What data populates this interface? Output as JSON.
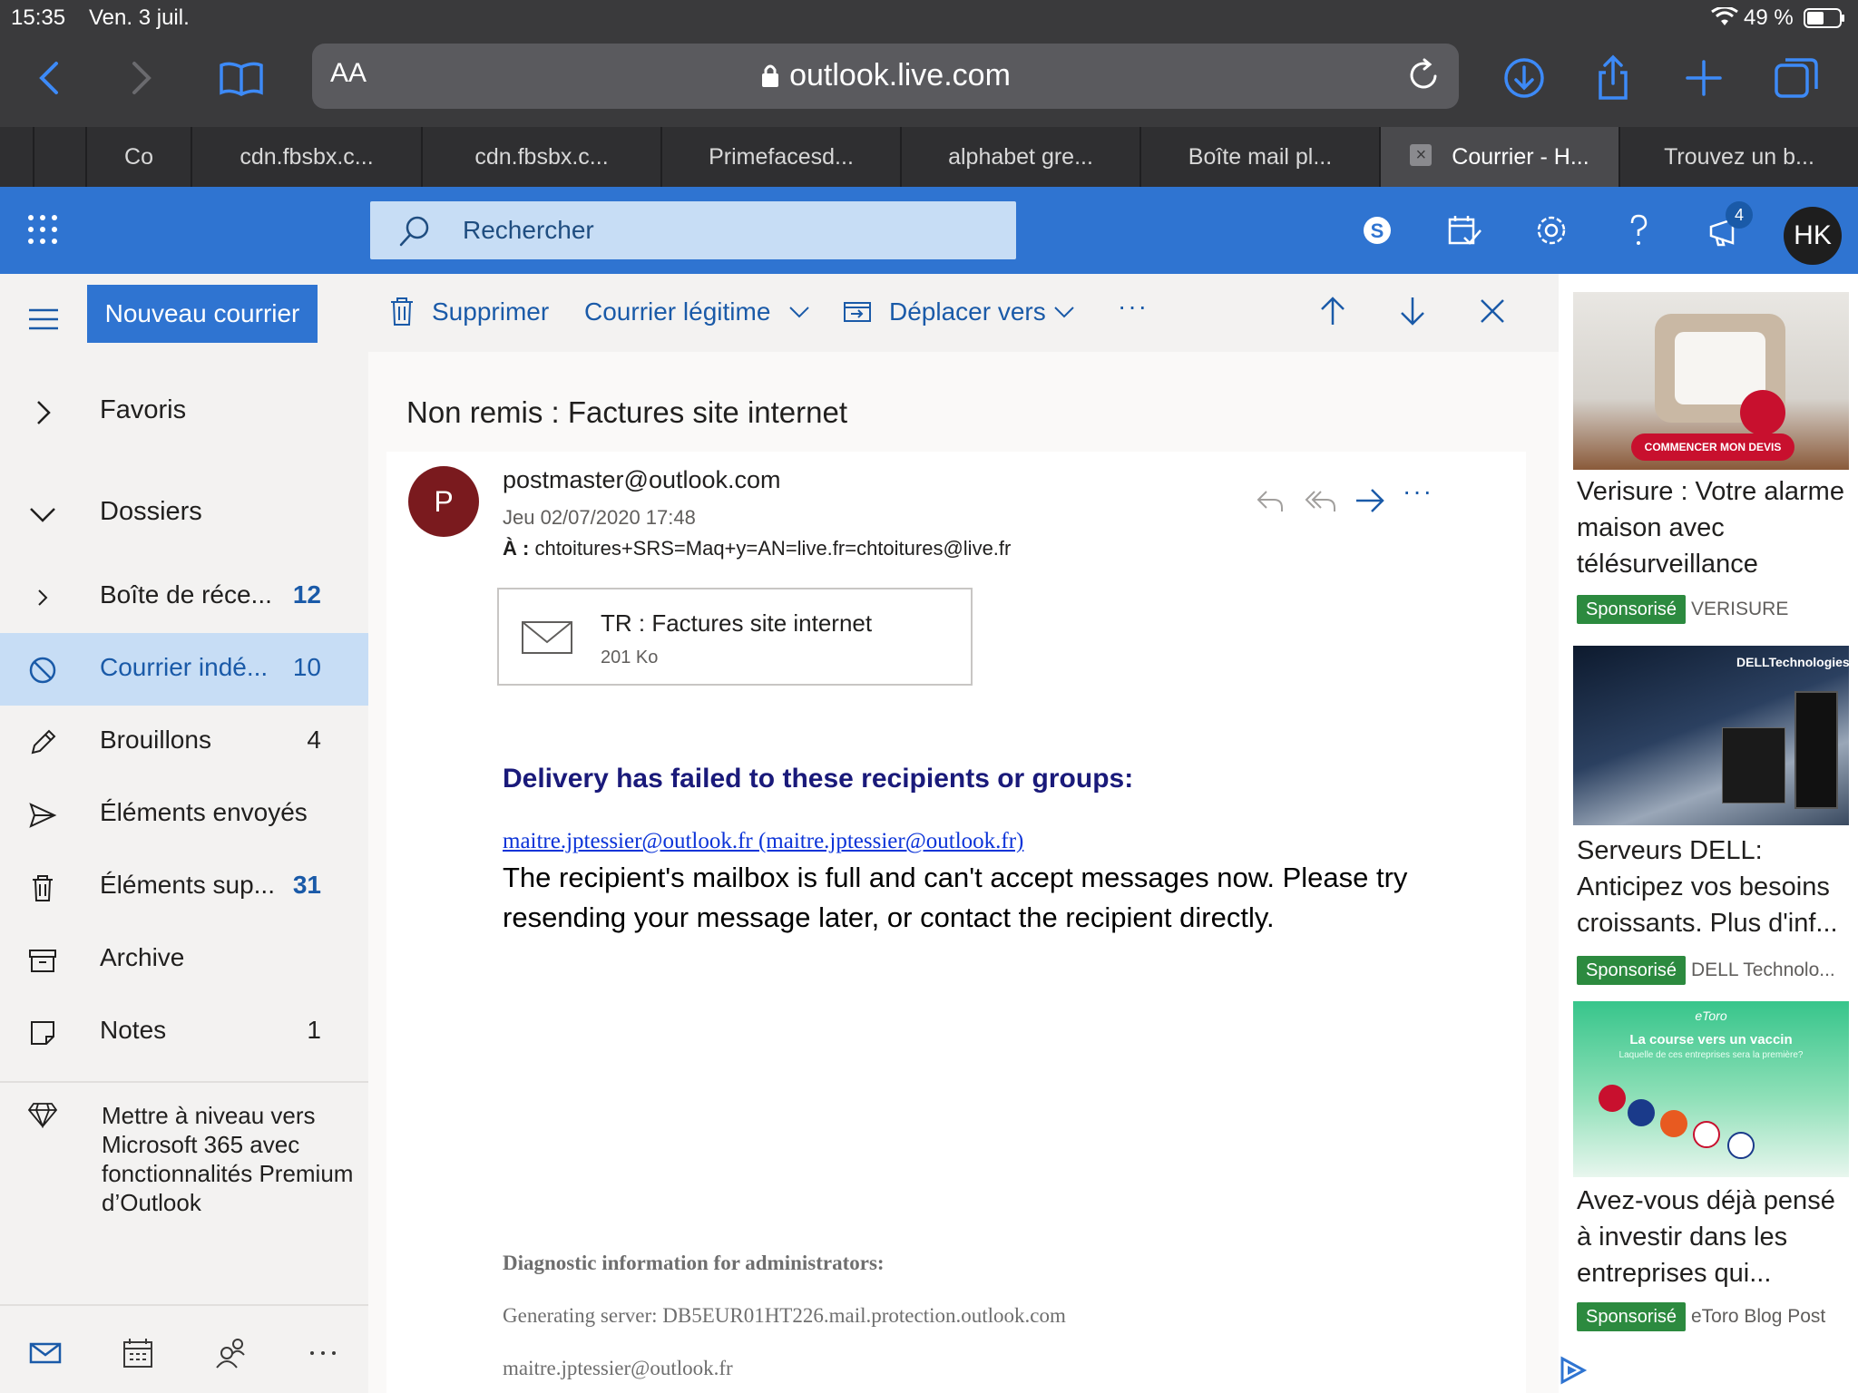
{
  "status_bar": {
    "time": "15:35",
    "date": "Ven. 3 juil.",
    "battery": "49 %"
  },
  "browser": {
    "aa_label": "AA",
    "url": "outlook.live.com",
    "tabs": [
      {
        "label": "Co"
      },
      {
        "label": "cdn.fbsbx.c..."
      },
      {
        "label": "cdn.fbsbx.c..."
      },
      {
        "label": "Primefacesd..."
      },
      {
        "label": "alphabet gre..."
      },
      {
        "label": "Boîte mail pl..."
      },
      {
        "label": "Courrier - H...",
        "active": true
      },
      {
        "label": "Trouvez un b..."
      }
    ],
    "tab_close_glyph": "×"
  },
  "header": {
    "search_placeholder": "Rechercher",
    "notification_count": "4",
    "user_initials": "HK"
  },
  "sidebar": {
    "new_mail_label": "Nouveau courrier",
    "favorites_label": "Favoris",
    "folders_label": "Dossiers",
    "folders": [
      {
        "label": "Boîte de réce...",
        "count": "12",
        "unread": true,
        "icon": "chevron-right-icon"
      },
      {
        "label": "Courrier indé...",
        "count": "10",
        "selected": true,
        "icon": "blocked-icon"
      },
      {
        "label": "Brouillons",
        "count": "4",
        "icon": "pencil-icon"
      },
      {
        "label": "Éléments envoyés",
        "count": "",
        "icon": "send-icon"
      },
      {
        "label": "Éléments sup...",
        "count": "31",
        "unread": true,
        "icon": "trash-icon"
      },
      {
        "label": "Archive",
        "count": "",
        "icon": "archive-icon"
      },
      {
        "label": "Notes",
        "count": "1",
        "icon": "note-icon"
      }
    ],
    "upgrade_text": "Mettre à niveau vers Microsoft 365 avec fonctionnalités Premium d’Outlook"
  },
  "commands": {
    "delete": "Supprimer",
    "legit": "Courrier légitime",
    "move": "Déplacer vers",
    "more": "···"
  },
  "message": {
    "subject": "Non remis : Factures site internet",
    "sender_initial": "P",
    "sender": "postmaster@outlook.com",
    "date": "Jeu 02/07/2020 17:48",
    "to_label": "À :",
    "to": "chtoitures+SRS=Maq+y=AN=live.fr=chtoitures@live.fr",
    "more": "···",
    "attachment": {
      "name": "TR : Factures site internet",
      "size": "201 Ko"
    },
    "body": {
      "fail_title": "Delivery has failed to these recipients or groups:",
      "fail_link": "maitre.jptessier@outlook.fr (maitre.jptessier@outlook.fr)",
      "fail_message": "The recipient's mailbox is full and can't accept messages now. Please try resending your message later, or contact the recipient directly.",
      "diag_title": "Diagnostic information for administrators:",
      "diag_server": "Generating server: DB5EUR01HT226.mail.protection.outlook.com",
      "diag_recipient": "maitre.jptessier@outlook.fr"
    }
  },
  "ads": [
    {
      "cta": "COMMENCER MON DEVIS",
      "title": "Verisure : Votre alarme maison avec télésurveillance",
      "badge": "Sponsorisé",
      "brand": "VERISURE"
    },
    {
      "logo": "DELLTechnologies",
      "title": "Serveurs DELL: Anticipez vos besoins croissants. Plus d'inf...",
      "badge": "Sponsorisé",
      "brand": "DELL Technolo..."
    },
    {
      "logo": "eToro",
      "headline": "La course vers un vaccin",
      "sub": "Laquelle de ces entreprises sera la première?",
      "title": "Avez-vous déjà pensé à investir dans les entreprises qui...",
      "badge": "Sponsorisé",
      "brand": "eToro Blog Post"
    }
  ],
  "colors": {
    "accent": "#2f74d1",
    "selected": "#c7ddf5",
    "sponsor": "#2c8a3f",
    "avatar": "#7a1a1e"
  }
}
